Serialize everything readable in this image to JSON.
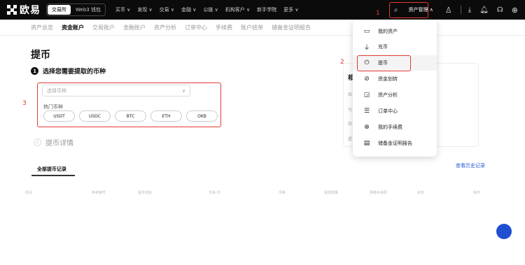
{
  "header": {
    "logo_text": "欧易",
    "mode_tabs": [
      "交易所",
      "Web3 钱包"
    ],
    "nav": [
      "买币 ∨",
      "发现 ∨",
      "交易 ∨",
      "金融 ∨",
      "公链 ∨",
      "机构客户 ∨",
      "新手学院",
      "更多 ∨"
    ],
    "asset_button": "资产管理 ∧",
    "icons": [
      "search-icon",
      "user-icon",
      "download-icon",
      "bell-icon",
      "headset-icon",
      "globe-icon"
    ]
  },
  "subnav": [
    "资产总览",
    "资金账户",
    "交易账户",
    "金融账户",
    "资产分析",
    "订单中心",
    "手续费",
    "账户结单",
    "储备金证明报告"
  ],
  "page": {
    "title": "提币",
    "step1_num": "1",
    "step1_label": "选择您需要提取的币种",
    "select_placeholder": "选择币种",
    "hot_label": "热门币种",
    "coins": [
      "USDT",
      "USDC",
      "BTC",
      "ETH",
      "OKB"
    ],
    "step2_num": "2",
    "step2_label": "提币详情"
  },
  "annotations": {
    "n1": "1",
    "n2": "2",
    "n3": "3"
  },
  "right_panel": {
    "title": "相",
    "lines": [
      "如",
      "为",
      "如",
      "提"
    ]
  },
  "records": {
    "tab": "全部提币记录",
    "history_link": "查看历史记录",
    "columns": [
      "时间",
      "参考编号",
      "提币地址",
      "交易 ID",
      "币种",
      "提现数量",
      "网络手续费",
      "状态",
      "操作"
    ]
  },
  "menu": {
    "items": [
      {
        "icon": "wallet-icon",
        "label": "我的资产"
      },
      {
        "icon": "deposit-icon",
        "label": "充币"
      },
      {
        "icon": "withdraw-icon",
        "label": "提币"
      },
      {
        "icon": "transfer-icon",
        "label": "资金划转"
      },
      {
        "icon": "analysis-icon",
        "label": "资产分析"
      },
      {
        "icon": "order-icon",
        "label": "订单中心"
      },
      {
        "icon": "fee-icon",
        "label": "我的手续费"
      },
      {
        "icon": "report-icon",
        "label": "储备金证明报告"
      }
    ]
  },
  "colors": {
    "annotation_red": "#e53935",
    "link_blue": "#2a5ad7",
    "header_bg": "#0b0b0b"
  }
}
